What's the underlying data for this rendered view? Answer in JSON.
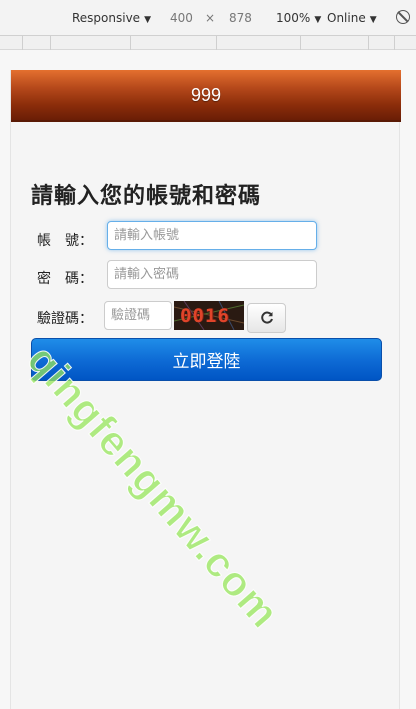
{
  "devtools": {
    "device": "Responsive",
    "width": "400",
    "times": "×",
    "height": "878",
    "zoom": "100%",
    "network": "Online"
  },
  "header": {
    "title": "999"
  },
  "form": {
    "heading": "請輸入您的帳號和密碼",
    "account_label": "帳　號：",
    "account_placeholder": "請輸入帳號",
    "password_label": "密　碼：",
    "password_placeholder": "請輸入密碼",
    "captcha_label": "驗證碼：",
    "captcha_placeholder": "驗證碼",
    "captcha_code": "0016",
    "login_button": "立即登陸"
  },
  "watermark": "qingfengmw.com",
  "colors": {
    "header": "#8b2d0a",
    "login_button": "#0d69d4",
    "watermark": "#96e65a"
  }
}
